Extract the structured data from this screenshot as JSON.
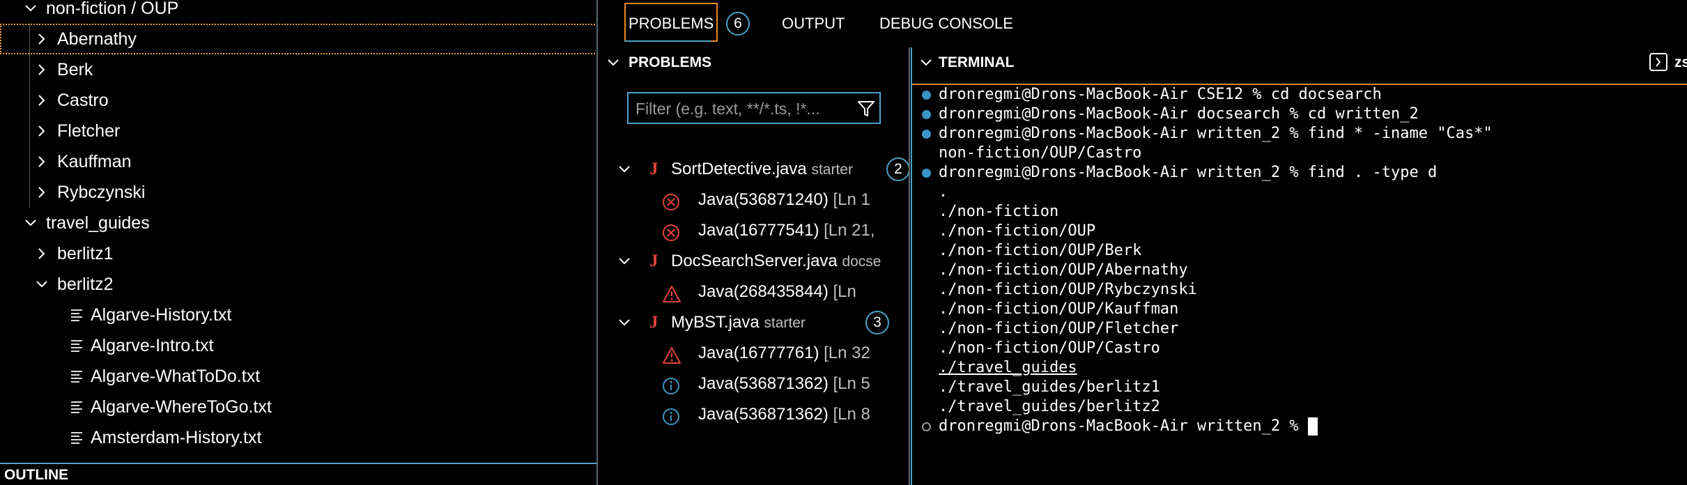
{
  "explorer": {
    "rows": [
      {
        "label": "non-fiction / OUP",
        "kind": "folder",
        "expanded": true
      },
      {
        "label": "Abernathy",
        "kind": "folder",
        "expanded": false
      },
      {
        "label": "Berk",
        "kind": "folder",
        "expanded": false
      },
      {
        "label": "Castro",
        "kind": "folder",
        "expanded": false
      },
      {
        "label": "Fletcher",
        "kind": "folder",
        "expanded": false
      },
      {
        "label": "Kauffman",
        "kind": "folder",
        "expanded": false
      },
      {
        "label": "Rybczynski",
        "kind": "folder",
        "expanded": false
      },
      {
        "label": "travel_guides",
        "kind": "folder",
        "expanded": true
      },
      {
        "label": "berlitz1",
        "kind": "folder",
        "expanded": false
      },
      {
        "label": "berlitz2",
        "kind": "folder",
        "expanded": true
      },
      {
        "label": "Algarve-History.txt",
        "kind": "file"
      },
      {
        "label": "Algarve-Intro.txt",
        "kind": "file"
      },
      {
        "label": "Algarve-WhatToDo.txt",
        "kind": "file"
      },
      {
        "label": "Algarve-WhereToGo.txt",
        "kind": "file"
      },
      {
        "label": "Amsterdam-History.txt",
        "kind": "file"
      }
    ],
    "outline_label": "OUTLINE"
  },
  "panel_tabs": {
    "problems": "PROBLEMS",
    "problems_count": "6",
    "output": "OUTPUT",
    "debug_console": "DEBUG CONSOLE"
  },
  "problems": {
    "header": "PROBLEMS",
    "filter_placeholder": "Filter (e.g. text, **/*.ts, !*...",
    "files": [
      {
        "name": "SortDetective.java",
        "path": "starter",
        "count": "2",
        "diagnostics": [
          {
            "severity": "error",
            "text": "Java(536871240)",
            "loc": "[Ln 1"
          },
          {
            "severity": "error",
            "text": "Java(16777541)",
            "loc": "[Ln 21,"
          }
        ]
      },
      {
        "name": "DocSearchServer.java",
        "path": "docse",
        "count": "",
        "diagnostics": [
          {
            "severity": "warning",
            "text": "Java(268435844)",
            "loc": "[Ln"
          }
        ]
      },
      {
        "name": "MyBST.java",
        "path": "starter",
        "count": "3",
        "diagnostics": [
          {
            "severity": "warning",
            "text": "Java(16777761)",
            "loc": "[Ln 32"
          },
          {
            "severity": "info",
            "text": "Java(536871362)",
            "loc": "[Ln 5"
          },
          {
            "severity": "info",
            "text": "Java(536871362)",
            "loc": "[Ln 8"
          }
        ]
      }
    ]
  },
  "terminal": {
    "header": "TERMINAL",
    "shell_label": "zs",
    "lines": [
      {
        "text": "dronregmi@Drons-MacBook-Air CSE12 % cd docsearch",
        "marker": "filled"
      },
      {
        "text": "dronregmi@Drons-MacBook-Air docsearch % cd written_2",
        "marker": "filled"
      },
      {
        "text": "dronregmi@Drons-MacBook-Air written_2 % find * -iname \"Cas*\"",
        "marker": "filled"
      },
      {
        "text": "non-fiction/OUP/Castro",
        "marker": ""
      },
      {
        "text": "dronregmi@Drons-MacBook-Air written_2 % find . -type d",
        "marker": "filled"
      },
      {
        "text": ".",
        "marker": ""
      },
      {
        "text": "./non-fiction",
        "marker": ""
      },
      {
        "text": "./non-fiction/OUP",
        "marker": ""
      },
      {
        "text": "./non-fiction/OUP/Berk",
        "marker": ""
      },
      {
        "text": "./non-fiction/OUP/Abernathy",
        "marker": ""
      },
      {
        "text": "./non-fiction/OUP/Rybczynski",
        "marker": ""
      },
      {
        "text": "./non-fiction/OUP/Kauffman",
        "marker": ""
      },
      {
        "text": "./non-fiction/OUP/Fletcher",
        "marker": ""
      },
      {
        "text": "./non-fiction/OUP/Castro",
        "marker": ""
      },
      {
        "text": "./travel_guides",
        "marker": "",
        "link": true
      },
      {
        "text": "./travel_guides/berlitz1",
        "marker": ""
      },
      {
        "text": "./travel_guides/berlitz2",
        "marker": ""
      },
      {
        "text": "dronregmi@Drons-MacBook-Air written_2 % ",
        "marker": "hollow",
        "cursor": true
      }
    ]
  },
  "colors": {
    "accent": "#4aa3c8",
    "focus": "#f08a24",
    "error": "#e0443c",
    "info": "#3a95c8"
  }
}
